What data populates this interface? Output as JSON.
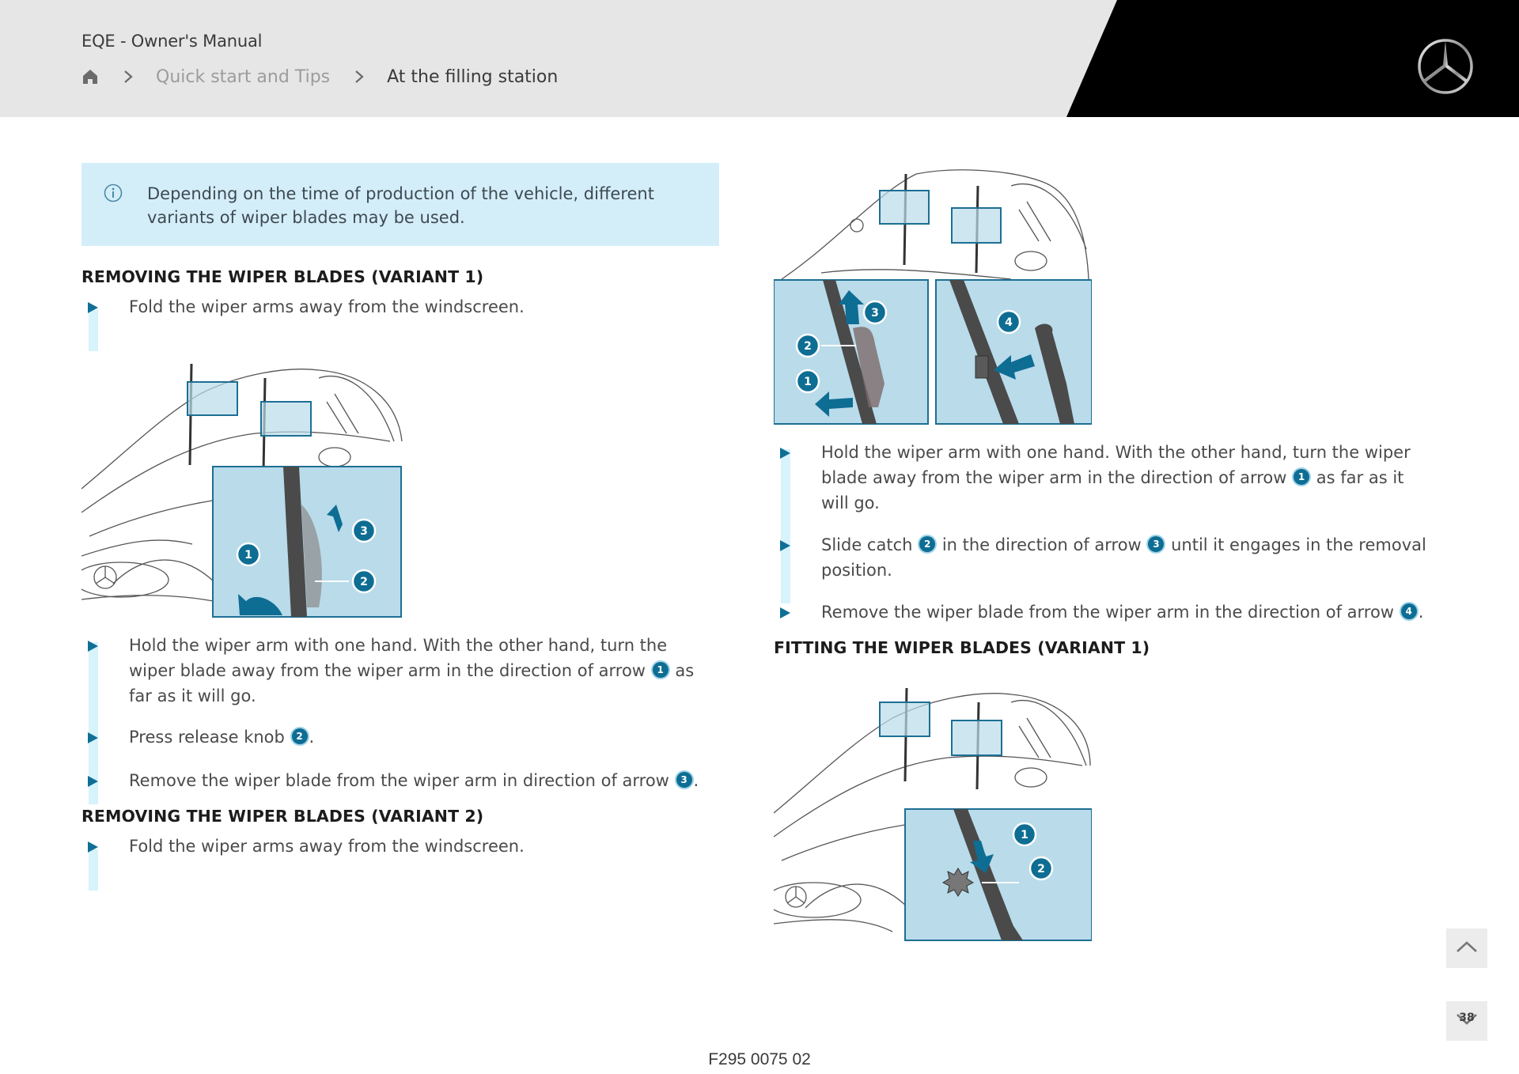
{
  "header": {
    "app_title": "EQE - Owner's Manual",
    "breadcrumb": {
      "home_icon": "home-icon",
      "items": [
        {
          "label": "Quick start and Tips"
        },
        {
          "label": "At the filling station"
        }
      ]
    },
    "logo": "mercedes-star-logo"
  },
  "info_note": {
    "icon": "info-icon",
    "text": "Depending on the time of production of the vehicle, different variants of wiper blades may be used."
  },
  "sections": {
    "removing_variant1": {
      "title": "REMOVING THE WIPER BLADES (VARIANT 1)",
      "intro_step": "Fold the wiper arms away from the windscreen.",
      "steps": [
        {
          "before": "Hold the wiper arm with one hand. With the other hand, turn the wiper blade away from the wiper arm in the direction of arrow",
          "ref": "1",
          "after": "as far as it will go."
        },
        {
          "before": "Press release knob",
          "ref": "2",
          "after": "."
        },
        {
          "before": "Remove the wiper blade from the wiper arm in direction of arrow",
          "ref": "3",
          "after": "."
        }
      ],
      "callouts": [
        "1",
        "2",
        "3"
      ]
    },
    "removing_variant2": {
      "title": "REMOVING THE WIPER BLADES (VARIANT 2)",
      "intro_step": "Fold the wiper arms away from the windscreen.",
      "steps": [
        {
          "before": "Hold the wiper arm with one hand. With the other hand, turn the wiper blade away from the wiper arm in the direction of arrow",
          "ref": "1",
          "after": "as far as it will go."
        },
        {
          "before": "Slide catch",
          "ref": "2",
          "mid": "in the direction of arrow",
          "ref2": "3",
          "after": "until it engages in the removal position."
        },
        {
          "before": "Remove the wiper blade from the wiper arm in the direction of arrow",
          "ref": "4",
          "after": "."
        }
      ],
      "callouts": [
        "1",
        "2",
        "3",
        "4"
      ]
    },
    "fitting_variant1": {
      "title": "FITTING THE WIPER BLADES (VARIANT 1)",
      "callouts": [
        "1",
        "2"
      ]
    }
  },
  "footer": {
    "figure_code": "F295 0075 02"
  },
  "nav": {
    "scroll_up_icon": "chevron-up-icon",
    "scroll_down_icon": "chevron-down-icon",
    "page_number": "38"
  },
  "colors": {
    "accent": "#0e6d93",
    "info_bg": "#d4eef9",
    "illustration_bg": "#b9dbea",
    "header_bg": "#e6e6e6"
  }
}
